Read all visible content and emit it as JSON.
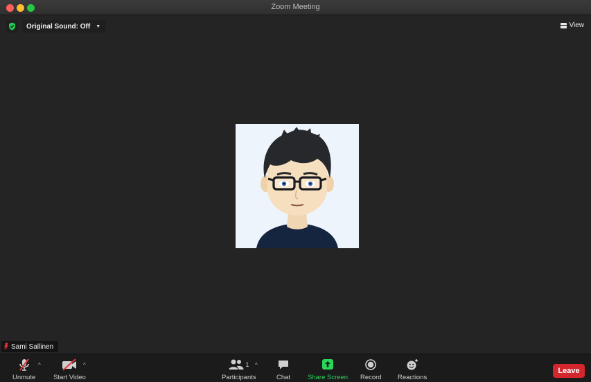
{
  "window": {
    "title": "Zoom Meeting"
  },
  "top_bar": {
    "sound_label": "Original Sound: Off",
    "view_label": "View"
  },
  "participant": {
    "name": "Sami Sallinen"
  },
  "toolbar": {
    "unmute": "Unmute",
    "start_video": "Start Video",
    "participants": "Participants",
    "participants_count": "1",
    "chat": "Chat",
    "share_screen": "Share Screen",
    "record": "Record",
    "reactions": "Reactions",
    "leave": "Leave"
  },
  "colors": {
    "accent_green": "#2bd55b",
    "leave_red": "#d3272d",
    "mute_red": "#e2343b",
    "secure_green": "#23c552"
  },
  "icons": {
    "secure": "shield-check-icon",
    "view": "grid-view-icon",
    "mute": "muted-microphone-icon",
    "video": "video-off-icon",
    "participants": "people-icon",
    "chat": "chat-bubble-icon",
    "share": "share-screen-arrow-icon",
    "record": "record-icon",
    "reactions": "emoji-plus-icon"
  }
}
